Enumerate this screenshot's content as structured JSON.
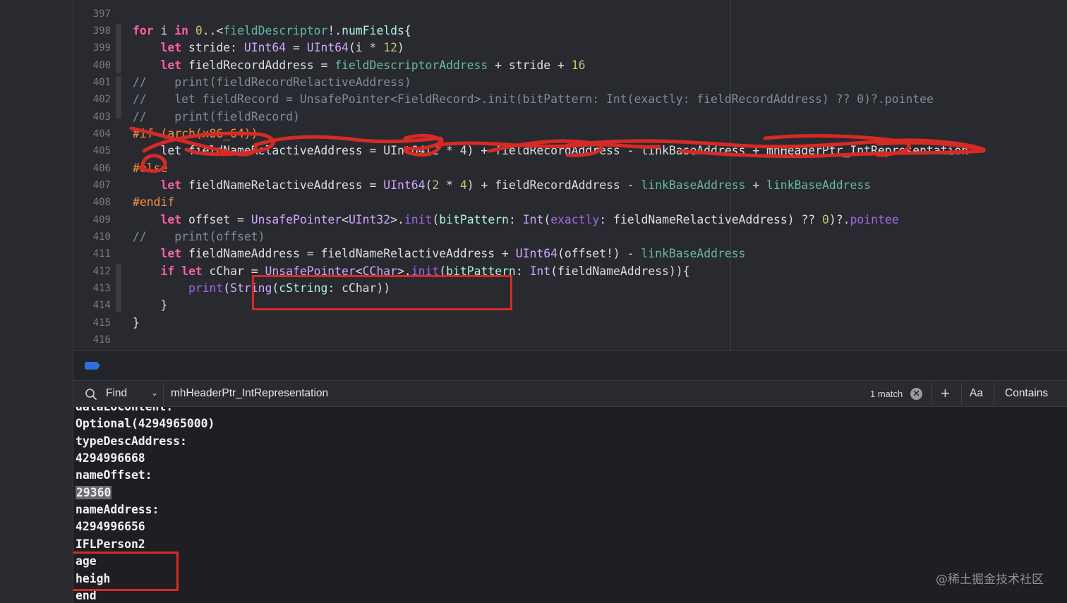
{
  "editor": {
    "line_numbers": [
      "397",
      "398",
      "399",
      "400",
      "401",
      "402",
      "403",
      "404",
      "405",
      "406",
      "407",
      "408",
      "409",
      "410",
      "411",
      "412",
      "413",
      "414",
      "415",
      "416"
    ],
    "lines": {
      "l398": [
        {
          "t": "for",
          "c": "kw"
        },
        {
          "t": " i ",
          "c": ""
        },
        {
          "t": "in",
          "c": "kw"
        },
        {
          "t": " ",
          "c": ""
        },
        {
          "t": "0",
          "c": "nm"
        },
        {
          "t": "..<",
          "c": ""
        },
        {
          "t": "fieldDescriptor",
          "c": "pm"
        },
        {
          "t": "!.",
          "c": ""
        },
        {
          "t": "numFields",
          "c": "tyb"
        },
        {
          "t": "{",
          "c": ""
        }
      ],
      "l399": [
        {
          "t": "    let",
          "c": "kw"
        },
        {
          "t": " stride: ",
          "c": ""
        },
        {
          "t": "UInt64",
          "c": "ty"
        },
        {
          "t": " = ",
          "c": ""
        },
        {
          "t": "UInt64",
          "c": "ty"
        },
        {
          "t": "(i * ",
          "c": ""
        },
        {
          "t": "12",
          "c": "nm"
        },
        {
          "t": ")",
          "c": ""
        }
      ],
      "l400": [
        {
          "t": "    let",
          "c": "kw"
        },
        {
          "t": " fieldRecordAddress = ",
          "c": ""
        },
        {
          "t": "fieldDescriptorAddress",
          "c": "pm"
        },
        {
          "t": " + stride + ",
          "c": ""
        },
        {
          "t": "16",
          "c": "nm"
        }
      ],
      "l401": [
        {
          "t": "//    print(fieldRecordRelactiveAddress)",
          "c": "cm"
        }
      ],
      "l402": [
        {
          "t": "//    let fieldRecord = UnsafePointer<FieldRecord>.init(bitPattern: Int(exactly: fieldRecordAddress) ?? 0)?.pointee",
          "c": "cm"
        }
      ],
      "l403": [
        {
          "t": "//    print(fieldRecord)",
          "c": "cm"
        }
      ],
      "l404": [
        {
          "t": "#if (arch(x86_64))",
          "c": "pp"
        }
      ],
      "l405": [
        {
          "t": "    let fieldNameRelactiveAddress = UInt64(2 * 4) + fieldRecordAddress - linkBaseAddress + mhHeaderPtr_IntRepresentation",
          "c": ""
        }
      ],
      "l406": [
        {
          "t": "#else",
          "c": "pp"
        }
      ],
      "l407": [
        {
          "t": "    let",
          "c": "kw"
        },
        {
          "t": " fieldNameRelactiveAddress = ",
          "c": ""
        },
        {
          "t": "UInt64",
          "c": "ty"
        },
        {
          "t": "(",
          "c": ""
        },
        {
          "t": "2",
          "c": "nm"
        },
        {
          "t": " * ",
          "c": ""
        },
        {
          "t": "4",
          "c": "nm"
        },
        {
          "t": ") + fieldRecordAddress - ",
          "c": ""
        },
        {
          "t": "linkBaseAddress",
          "c": "pm"
        },
        {
          "t": " + ",
          "c": ""
        },
        {
          "t": "linkBaseAddress",
          "c": "pm"
        }
      ],
      "l408": [
        {
          "t": "#endif",
          "c": "pp"
        }
      ],
      "l409": [
        {
          "t": "    let",
          "c": "kw"
        },
        {
          "t": " offset = ",
          "c": ""
        },
        {
          "t": "UnsafePointer",
          "c": "ty"
        },
        {
          "t": "<",
          "c": ""
        },
        {
          "t": "UInt32",
          "c": "ty"
        },
        {
          "t": ">.",
          "c": ""
        },
        {
          "t": "init",
          "c": "fn"
        },
        {
          "t": "(",
          "c": ""
        },
        {
          "t": "bitPattern",
          "c": "tyb"
        },
        {
          "t": ": ",
          "c": ""
        },
        {
          "t": "Int",
          "c": "ty"
        },
        {
          "t": "(",
          "c": ""
        },
        {
          "t": "exactly",
          "c": "fn"
        },
        {
          "t": ": fieldNameRelactiveAddress) ?? ",
          "c": ""
        },
        {
          "t": "0",
          "c": "nm"
        },
        {
          "t": ")?.",
          "c": ""
        },
        {
          "t": "pointee",
          "c": "fn"
        }
      ],
      "l410": [
        {
          "t": "//    print(offset)",
          "c": "cm"
        }
      ],
      "l411": [
        {
          "t": "    let",
          "c": "kw"
        },
        {
          "t": " fieldNameAddress = fieldNameRelactiveAddress + ",
          "c": ""
        },
        {
          "t": "UInt64",
          "c": "ty"
        },
        {
          "t": "(offset!) - ",
          "c": ""
        },
        {
          "t": "linkBaseAddress",
          "c": "pm"
        }
      ],
      "l412": [
        {
          "t": "    if let",
          "c": "kw"
        },
        {
          "t": " cChar = ",
          "c": ""
        },
        {
          "t": "UnsafePointer",
          "c": "ty"
        },
        {
          "t": "<",
          "c": ""
        },
        {
          "t": "CChar",
          "c": "ty"
        },
        {
          "t": ">.",
          "c": ""
        },
        {
          "t": "init",
          "c": "fn"
        },
        {
          "t": "(",
          "c": ""
        },
        {
          "t": "bitPattern",
          "c": "tyb"
        },
        {
          "t": ": ",
          "c": ""
        },
        {
          "t": "Int",
          "c": "ty"
        },
        {
          "t": "(fieldNameAddress)){",
          "c": ""
        }
      ],
      "l413": [
        {
          "t": "        ",
          "c": ""
        },
        {
          "t": "print",
          "c": "fn"
        },
        {
          "t": "(",
          "c": ""
        },
        {
          "t": "String",
          "c": "ty"
        },
        {
          "t": "(",
          "c": ""
        },
        {
          "t": "cString",
          "c": "tyb"
        },
        {
          "t": ": cChar))",
          "c": ""
        }
      ],
      "l414": [
        {
          "t": "    }",
          "c": ""
        }
      ],
      "l415": [
        {
          "t": "}",
          "c": ""
        }
      ]
    }
  },
  "find_bar": {
    "mode_label": "Find",
    "query": "mhHeaderPtr_IntRepresentation",
    "match_count": "1 match",
    "clear_glyph": "✕",
    "add_glyph": "+",
    "case_label": "Aa",
    "match_type": "Contains"
  },
  "console": {
    "lines": [
      "dataLoContent:",
      "Optional(4294965000)",
      "typeDescAddress:",
      "4294996668",
      "nameOffset:",
      "29360",
      "nameAddress:",
      "4294996656",
      "IFLPerson2",
      "age",
      "heigh",
      "end"
    ],
    "highlight_index": 5
  },
  "watermark": "@稀土掘金技术社区",
  "colors": {
    "annotation_red": "#d62a25",
    "editor_bg": "#292a30",
    "console_bg": "#1e1f22"
  }
}
